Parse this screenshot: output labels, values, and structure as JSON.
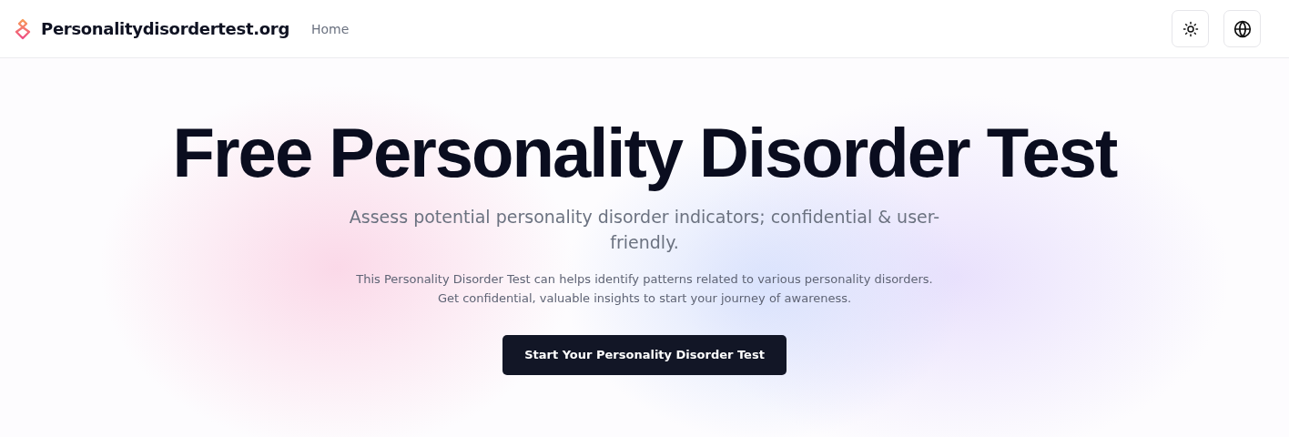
{
  "header": {
    "site_name": "Personalitydisordertest.org",
    "nav": [
      {
        "label": "Home"
      }
    ]
  },
  "hero": {
    "title": "Free Personality Disorder Test",
    "subtitle": "Assess potential personality disorder indicators; confidential & user-friendly.",
    "description": "This Personality Disorder Test can helps identify patterns related to various personality disorders. Get confidential, valuable insights to start your journey of awareness.",
    "cta": "Start Your Personality Disorder Test"
  }
}
